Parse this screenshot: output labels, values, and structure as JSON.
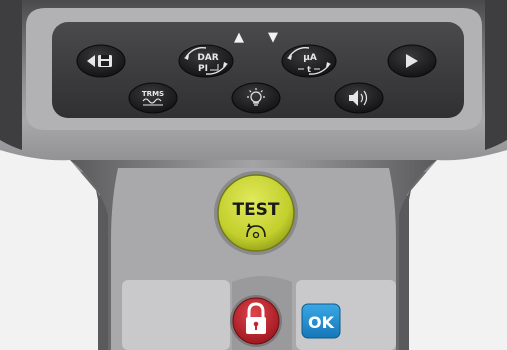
{
  "colors": {
    "body_dark": "#3c3c3e",
    "body_grey": "#9a9a9c",
    "panel": "#3a3a3c",
    "key": "#1c1c1e",
    "test_yellow": "#c9d53a",
    "lock_red": "#c8232c",
    "ok_blue": "#1e8fd0"
  },
  "keys": {
    "save_back": {
      "icon": "arrow-left-save-icon"
    },
    "dar_pi": {
      "top": "DAR",
      "bottom": "PI",
      "icon": "dar-pi-cycle-icon"
    },
    "ua_ti": {
      "top": "µA",
      "bottom": "t",
      "icon": "current-time-cycle-icon"
    },
    "forward": {
      "icon": "arrow-right-icon"
    },
    "trms": {
      "label": "TRMS",
      "icon": "trms-waveform-icon"
    },
    "backlight": {
      "icon": "backlight-bulb-icon"
    },
    "sound": {
      "icon": "speaker-icon"
    }
  },
  "arrows": {
    "up": "▲",
    "down": "▼"
  },
  "test_button": {
    "label": "TEST",
    "icon": "hold-rotate-icon"
  },
  "lock_button": {
    "icon": "padlock-icon"
  },
  "ok_button": {
    "label": "OK"
  }
}
